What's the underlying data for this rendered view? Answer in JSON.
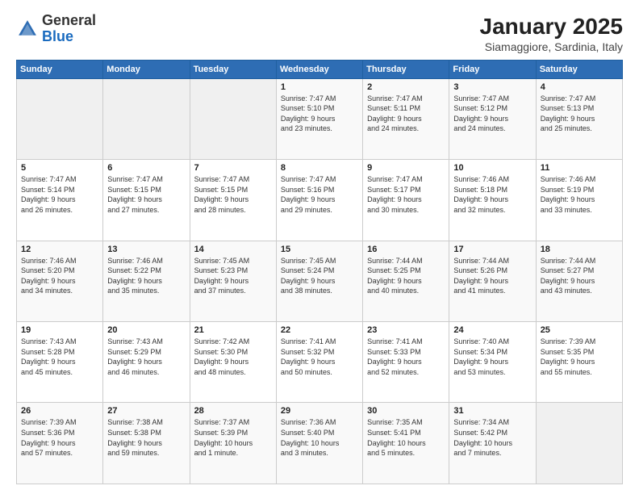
{
  "logo": {
    "general": "General",
    "blue": "Blue"
  },
  "title": "January 2025",
  "subtitle": "Siamaggiore, Sardinia, Italy",
  "weekdays": [
    "Sunday",
    "Monday",
    "Tuesday",
    "Wednesday",
    "Thursday",
    "Friday",
    "Saturday"
  ],
  "weeks": [
    [
      {
        "day": "",
        "info": ""
      },
      {
        "day": "",
        "info": ""
      },
      {
        "day": "",
        "info": ""
      },
      {
        "day": "1",
        "info": "Sunrise: 7:47 AM\nSunset: 5:10 PM\nDaylight: 9 hours\nand 23 minutes."
      },
      {
        "day": "2",
        "info": "Sunrise: 7:47 AM\nSunset: 5:11 PM\nDaylight: 9 hours\nand 24 minutes."
      },
      {
        "day": "3",
        "info": "Sunrise: 7:47 AM\nSunset: 5:12 PM\nDaylight: 9 hours\nand 24 minutes."
      },
      {
        "day": "4",
        "info": "Sunrise: 7:47 AM\nSunset: 5:13 PM\nDaylight: 9 hours\nand 25 minutes."
      }
    ],
    [
      {
        "day": "5",
        "info": "Sunrise: 7:47 AM\nSunset: 5:14 PM\nDaylight: 9 hours\nand 26 minutes."
      },
      {
        "day": "6",
        "info": "Sunrise: 7:47 AM\nSunset: 5:15 PM\nDaylight: 9 hours\nand 27 minutes."
      },
      {
        "day": "7",
        "info": "Sunrise: 7:47 AM\nSunset: 5:15 PM\nDaylight: 9 hours\nand 28 minutes."
      },
      {
        "day": "8",
        "info": "Sunrise: 7:47 AM\nSunset: 5:16 PM\nDaylight: 9 hours\nand 29 minutes."
      },
      {
        "day": "9",
        "info": "Sunrise: 7:47 AM\nSunset: 5:17 PM\nDaylight: 9 hours\nand 30 minutes."
      },
      {
        "day": "10",
        "info": "Sunrise: 7:46 AM\nSunset: 5:18 PM\nDaylight: 9 hours\nand 32 minutes."
      },
      {
        "day": "11",
        "info": "Sunrise: 7:46 AM\nSunset: 5:19 PM\nDaylight: 9 hours\nand 33 minutes."
      }
    ],
    [
      {
        "day": "12",
        "info": "Sunrise: 7:46 AM\nSunset: 5:20 PM\nDaylight: 9 hours\nand 34 minutes."
      },
      {
        "day": "13",
        "info": "Sunrise: 7:46 AM\nSunset: 5:22 PM\nDaylight: 9 hours\nand 35 minutes."
      },
      {
        "day": "14",
        "info": "Sunrise: 7:45 AM\nSunset: 5:23 PM\nDaylight: 9 hours\nand 37 minutes."
      },
      {
        "day": "15",
        "info": "Sunrise: 7:45 AM\nSunset: 5:24 PM\nDaylight: 9 hours\nand 38 minutes."
      },
      {
        "day": "16",
        "info": "Sunrise: 7:44 AM\nSunset: 5:25 PM\nDaylight: 9 hours\nand 40 minutes."
      },
      {
        "day": "17",
        "info": "Sunrise: 7:44 AM\nSunset: 5:26 PM\nDaylight: 9 hours\nand 41 minutes."
      },
      {
        "day": "18",
        "info": "Sunrise: 7:44 AM\nSunset: 5:27 PM\nDaylight: 9 hours\nand 43 minutes."
      }
    ],
    [
      {
        "day": "19",
        "info": "Sunrise: 7:43 AM\nSunset: 5:28 PM\nDaylight: 9 hours\nand 45 minutes."
      },
      {
        "day": "20",
        "info": "Sunrise: 7:43 AM\nSunset: 5:29 PM\nDaylight: 9 hours\nand 46 minutes."
      },
      {
        "day": "21",
        "info": "Sunrise: 7:42 AM\nSunset: 5:30 PM\nDaylight: 9 hours\nand 48 minutes."
      },
      {
        "day": "22",
        "info": "Sunrise: 7:41 AM\nSunset: 5:32 PM\nDaylight: 9 hours\nand 50 minutes."
      },
      {
        "day": "23",
        "info": "Sunrise: 7:41 AM\nSunset: 5:33 PM\nDaylight: 9 hours\nand 52 minutes."
      },
      {
        "day": "24",
        "info": "Sunrise: 7:40 AM\nSunset: 5:34 PM\nDaylight: 9 hours\nand 53 minutes."
      },
      {
        "day": "25",
        "info": "Sunrise: 7:39 AM\nSunset: 5:35 PM\nDaylight: 9 hours\nand 55 minutes."
      }
    ],
    [
      {
        "day": "26",
        "info": "Sunrise: 7:39 AM\nSunset: 5:36 PM\nDaylight: 9 hours\nand 57 minutes."
      },
      {
        "day": "27",
        "info": "Sunrise: 7:38 AM\nSunset: 5:38 PM\nDaylight: 9 hours\nand 59 minutes."
      },
      {
        "day": "28",
        "info": "Sunrise: 7:37 AM\nSunset: 5:39 PM\nDaylight: 10 hours\nand 1 minute."
      },
      {
        "day": "29",
        "info": "Sunrise: 7:36 AM\nSunset: 5:40 PM\nDaylight: 10 hours\nand 3 minutes."
      },
      {
        "day": "30",
        "info": "Sunrise: 7:35 AM\nSunset: 5:41 PM\nDaylight: 10 hours\nand 5 minutes."
      },
      {
        "day": "31",
        "info": "Sunrise: 7:34 AM\nSunset: 5:42 PM\nDaylight: 10 hours\nand 7 minutes."
      },
      {
        "day": "",
        "info": ""
      }
    ]
  ]
}
